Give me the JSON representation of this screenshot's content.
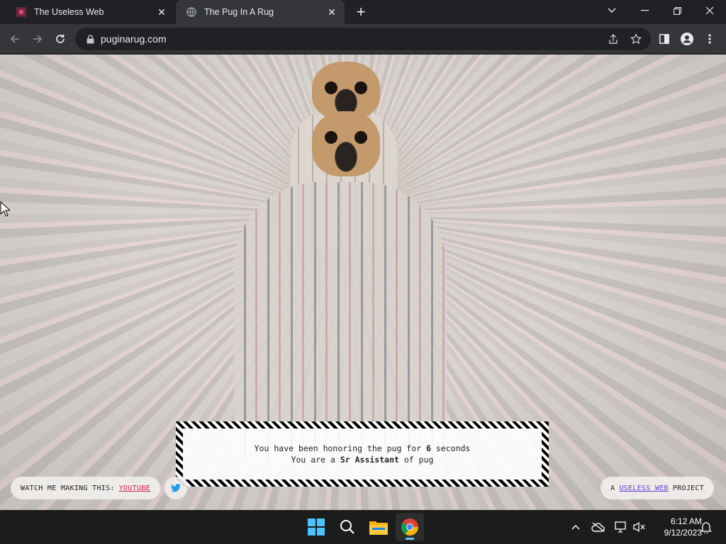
{
  "browser": {
    "tabs": [
      {
        "title": "The Useless Web",
        "active": false,
        "favicon": "useless-web-favicon"
      },
      {
        "title": "The Pug In A Rug",
        "active": true,
        "favicon": "globe-icon"
      }
    ],
    "url": "puginarug.com"
  },
  "page": {
    "message_line1_prefix": "You have been honoring the pug for",
    "seconds": "6",
    "message_line1_suffix": "seconds",
    "message_line2_prefix": "You are a",
    "rank": "Sr Assistant",
    "message_line2_suffix": "of pug",
    "youtube_prefix": "WATCH ME MAKING THIS:",
    "youtube_link": "YOUTUBE",
    "project_prefix": "A",
    "project_link": "USELESS WEB",
    "project_suffix": "PROJECT"
  },
  "taskbar": {
    "time": "6:12 AM",
    "date": "9/12/2023"
  },
  "colors": {
    "link_red": "#d0234e",
    "link_purple": "#6b3fd6",
    "chrome_dark": "#202124",
    "chrome_toolbar": "#35363a",
    "taskbar_accent": "#60cdff"
  }
}
